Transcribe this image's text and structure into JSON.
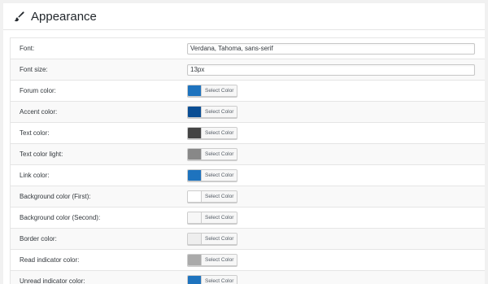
{
  "header": {
    "title": "Appearance",
    "icon": "paintbrush-icon"
  },
  "colors": {
    "accent": "#1e73be"
  },
  "rows": [
    {
      "label": "Font:",
      "type": "text",
      "value": "Verdana, Tahoma, sans-serif"
    },
    {
      "label": "Font size:",
      "type": "text",
      "value": "13px"
    },
    {
      "label": "Forum color:",
      "type": "color",
      "color": "#1e73be",
      "button": "Select Color"
    },
    {
      "label": "Accent color:",
      "type": "color",
      "color": "#0a4e94",
      "button": "Select Color"
    },
    {
      "label": "Text color:",
      "type": "color",
      "color": "#444444",
      "button": "Select Color"
    },
    {
      "label": "Text color light:",
      "type": "color",
      "color": "#888888",
      "button": "Select Color"
    },
    {
      "label": "Link color:",
      "type": "color",
      "color": "#1e73be",
      "button": "Select Color"
    },
    {
      "label": "Background color (First):",
      "type": "color",
      "color": "#ffffff",
      "button": "Select Color"
    },
    {
      "label": "Background color (Second):",
      "type": "color",
      "color": "#f7f7f7",
      "button": "Select Color"
    },
    {
      "label": "Border color:",
      "type": "color",
      "color": "#eeeeee",
      "button": "Select Color"
    },
    {
      "label": "Read indicator color:",
      "type": "color",
      "color": "#aaaaaa",
      "button": "Select Color"
    },
    {
      "label": "Unread indicator color:",
      "type": "color",
      "color": "#1e73be",
      "button": "Select Color"
    }
  ]
}
